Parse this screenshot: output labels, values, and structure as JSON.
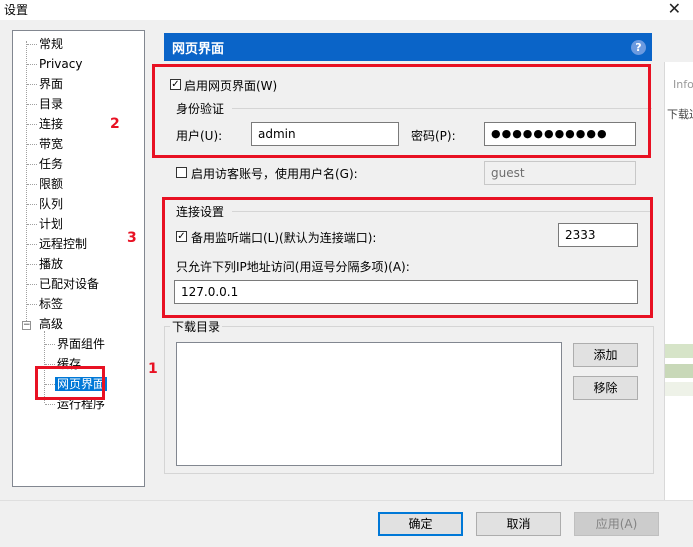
{
  "window": {
    "title": "设置",
    "close_glyph": "✕"
  },
  "tree": {
    "items": [
      {
        "label": "常规"
      },
      {
        "label": "Privacy"
      },
      {
        "label": "界面"
      },
      {
        "label": "目录"
      },
      {
        "label": "连接"
      },
      {
        "label": "带宽"
      },
      {
        "label": "任务"
      },
      {
        "label": "限额"
      },
      {
        "label": "队列"
      },
      {
        "label": "计划"
      },
      {
        "label": "远程控制"
      },
      {
        "label": "播放"
      },
      {
        "label": "已配对设备"
      },
      {
        "label": "标签"
      },
      {
        "label": "高级"
      },
      {
        "label": "界面组件"
      },
      {
        "label": "缓存"
      },
      {
        "label": "网页界面"
      },
      {
        "label": "运行程序"
      }
    ],
    "expander_glyph": "−",
    "selected": "网页界面"
  },
  "panel": {
    "title": "网页界面",
    "help_glyph": "?",
    "enable_webui": {
      "label": "启用网页界面(W)",
      "checked": true
    },
    "auth": {
      "group_title": "身份验证",
      "user_label": "用户(U):",
      "user_value": "admin",
      "password_label": "密码(P):",
      "password_value": "●●●●●●●●●●●"
    },
    "guest": {
      "label": "启用访客账号，使用用户名(G):",
      "checked": false,
      "value": "guest"
    },
    "connection": {
      "group_title": "连接设置",
      "alt_port_label": "备用监听端口(L)(默认为连接端口):",
      "alt_port_checked": true,
      "alt_port_value": "2333",
      "ip_label": "只允许下列IP地址访问(用逗号分隔多项)(A):",
      "ip_value": "127.0.0.1"
    },
    "downloads": {
      "group_title": "下载目录",
      "add_label": "添加",
      "remove_label": "移除"
    }
  },
  "buttons": {
    "ok": "确定",
    "cancel": "取消",
    "apply": "应用(A)"
  },
  "annotations": {
    "n1": "1",
    "n2": "2",
    "n3": "3",
    "color": "#e81123"
  },
  "background": {
    "strip_text_1": "Info",
    "strip_text_2": "下载过"
  },
  "check_glyph": "✓",
  "colors": {
    "header_blue": "#0a64c8",
    "selection_blue": "#0078d7"
  }
}
